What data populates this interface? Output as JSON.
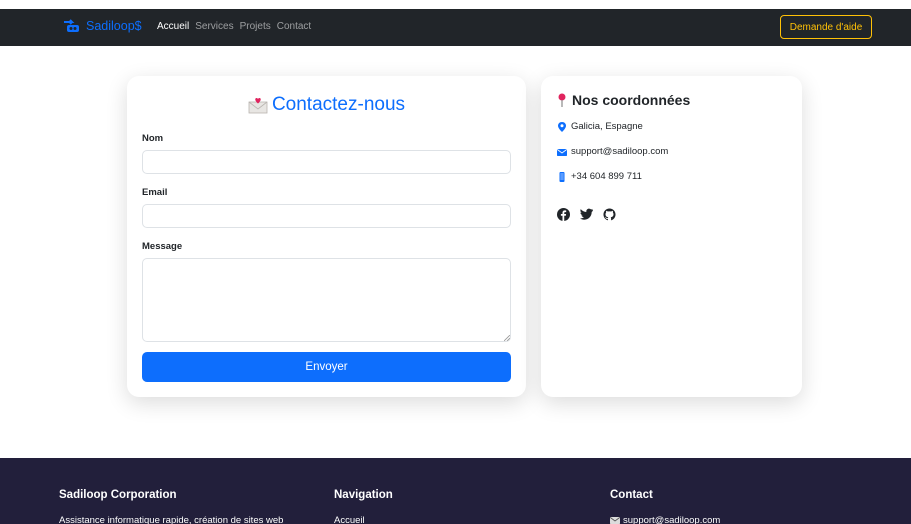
{
  "navbar": {
    "brand": "Sadiloop$",
    "links": [
      "Accueil",
      "Services",
      "Projets",
      "Contact"
    ],
    "help_button": "Demande d'aide"
  },
  "form": {
    "title": "Contactez-nous",
    "name_label": "Nom",
    "name_value": "",
    "email_label": "Email",
    "email_value": "",
    "message_label": "Message",
    "message_value": "",
    "submit_label": "Envoyer"
  },
  "info": {
    "title": "Nos coordonnées",
    "location": "Galicia, Espagne",
    "email": "support@sadiloop.com",
    "phone": "+34 604 899 711",
    "socials": [
      "facebook-icon",
      "twitter-icon",
      "github-icon"
    ]
  },
  "footer": {
    "company_title": "Sadiloop Corporation",
    "company_text": "Assistance informatique rapide, création de sites web",
    "nav_title": "Navigation",
    "nav_first_link": "Accueil",
    "contact_title": "Contact",
    "contact_email": "support@sadiloop.com"
  },
  "colors": {
    "navbar_bg": "#212529",
    "accent_blue": "#0d6efd",
    "help_yellow": "#ffc107",
    "footer_bg": "#221f3b"
  }
}
